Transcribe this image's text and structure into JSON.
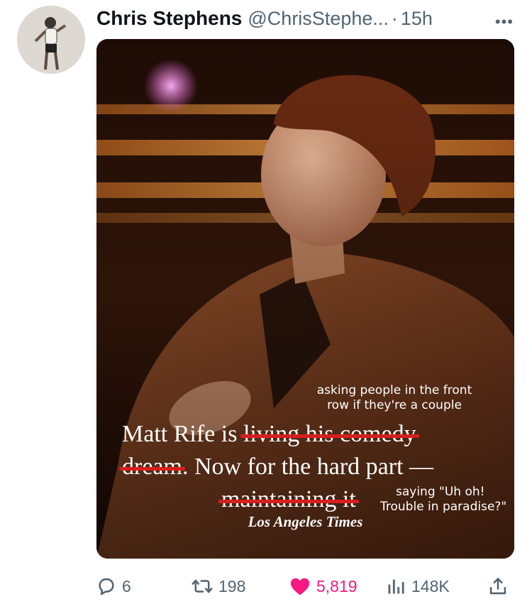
{
  "author": {
    "name": "Chris Stephens",
    "handle": "@ChrisStephe...",
    "separator": "·",
    "time": "15h",
    "more_icon": "more-horizontal-icon"
  },
  "media": {
    "caption_top": [
      "asking people in the front",
      "row if they're a couple"
    ],
    "headline": {
      "p1": "Matt Rife is ",
      "s1": "living his comedy",
      "s2": "dream",
      "p2": ". Now for the hard part —",
      "s3": "maintaining it"
    },
    "caption_bottom": [
      "saying \"Uh oh!",
      "Trouble in paradise?\""
    ],
    "publisher": "Los Angeles Times"
  },
  "actions": {
    "replies": "6",
    "reposts": "198",
    "likes": "5,819",
    "views": "148K",
    "accent_like": "#f91880",
    "muted": "#536471"
  }
}
